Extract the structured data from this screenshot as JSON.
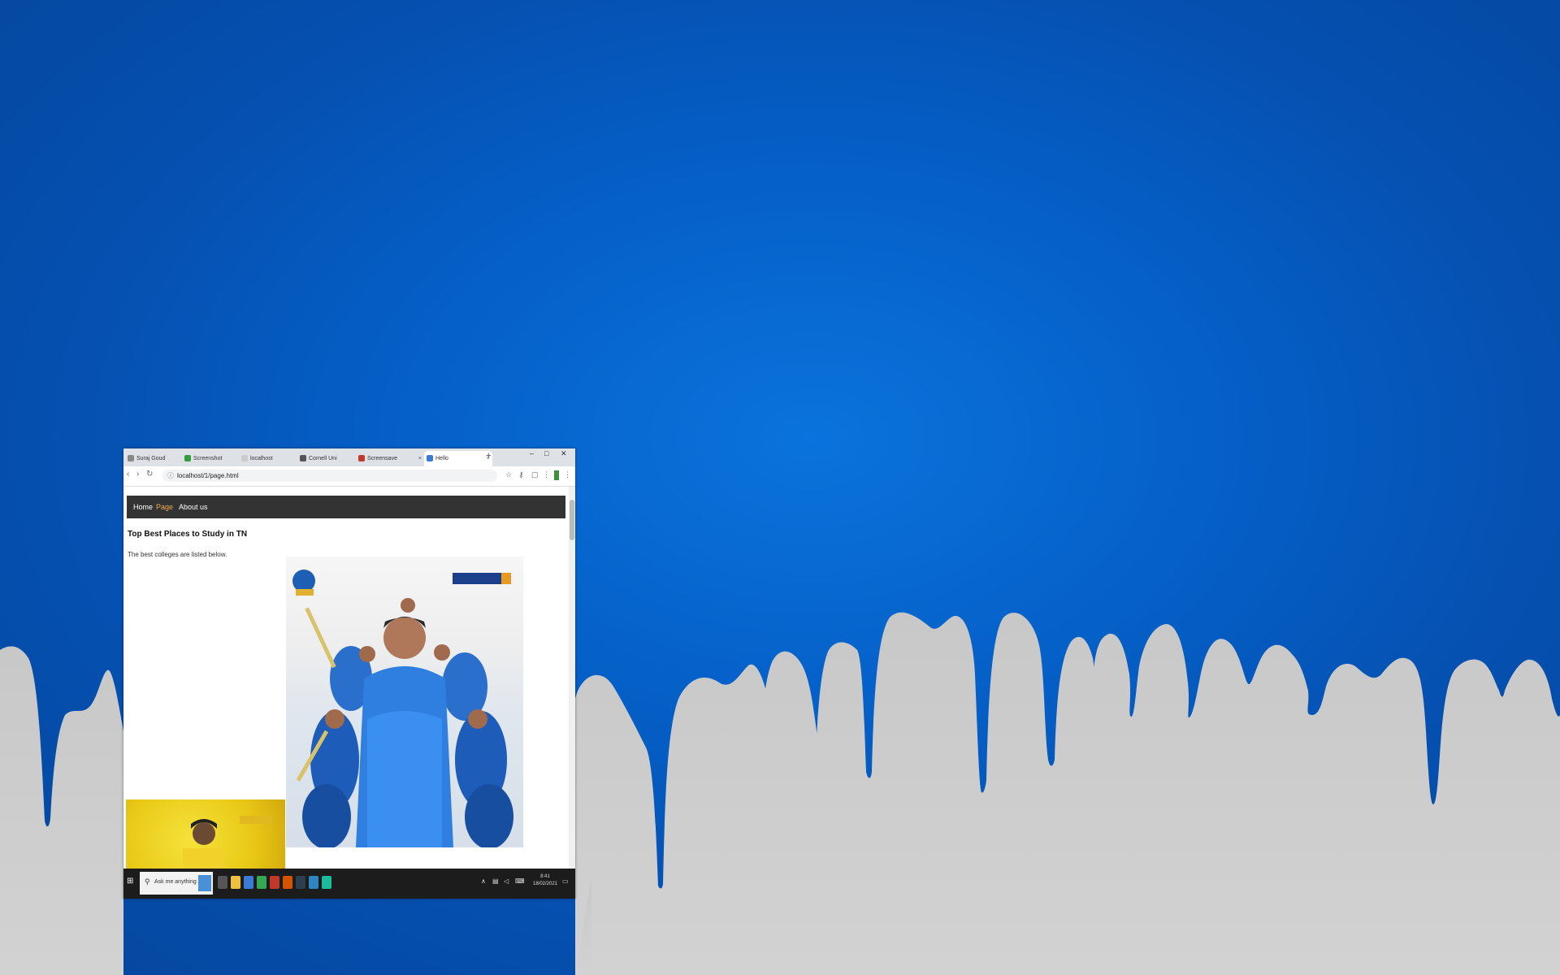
{
  "desktop": {
    "wallpaper_top_color": "#0560c8",
    "wallpaper_bottom_color": "#cccccc"
  },
  "browser": {
    "tabs": [
      {
        "label": "Suraj Goud",
        "favicon_color": "#888888"
      },
      {
        "label": "Screenshot",
        "favicon_color": "#2e9e3e"
      },
      {
        "label": "localhost",
        "favicon_color": "#cccccc"
      },
      {
        "label": "Cornell Uni",
        "favicon_color": "#555555"
      },
      {
        "label": "Screensave",
        "favicon_color": "#c0392b"
      },
      {
        "label": "Hello",
        "favicon_color": "#3a7bd5"
      }
    ],
    "address": "localhost/1/page.html",
    "window_controls": [
      "–",
      "□",
      "✕"
    ]
  },
  "site": {
    "nav": [
      {
        "label": "Home",
        "current": false
      },
      {
        "label": "Page",
        "current": true
      },
      {
        "label": "About us",
        "current": false
      }
    ],
    "heading": "Top Best Places to Study in TN",
    "lead": "The best colleges are listed below."
  },
  "taskbar": {
    "search_placeholder": "Ask me anything",
    "time": "8:41",
    "date": "18/02/2021"
  }
}
